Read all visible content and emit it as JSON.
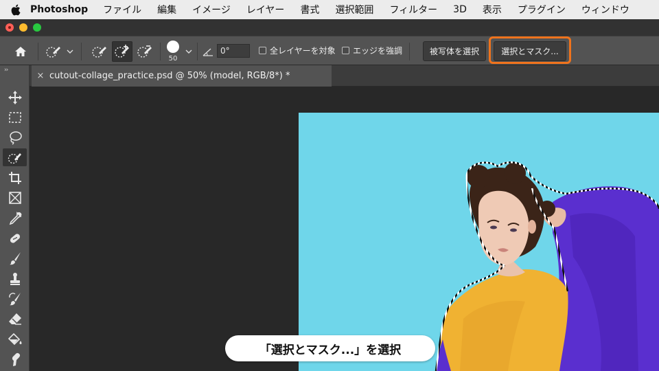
{
  "menubar": {
    "app_name": "Photoshop",
    "items": [
      "ファイル",
      "編集",
      "イメージ",
      "レイヤー",
      "書式",
      "選択範囲",
      "フィルター",
      "3D",
      "表示",
      "プラグイン",
      "ウィンドウ"
    ]
  },
  "options_bar": {
    "brush_size": "50",
    "angle_value": "0°",
    "sample_all_layers_label": "全レイヤーを対象",
    "sample_all_layers_checked": false,
    "auto_enhance_label": "エッジを強調",
    "auto_enhance_checked": false,
    "select_subject_label": "被写体を選択",
    "select_and_mask_label": "選択とマスク..."
  },
  "toolbar": {
    "collapse_glyph": "››",
    "tools": [
      {
        "icon": "move-icon"
      },
      {
        "icon": "marquee-icon"
      },
      {
        "icon": "lasso-icon"
      },
      {
        "icon": "quick-selection-icon",
        "active": true
      },
      {
        "icon": "crop-icon"
      },
      {
        "icon": "frame-icon"
      },
      {
        "icon": "eyedropper-icon"
      },
      {
        "icon": "healing-brush-icon"
      },
      {
        "icon": "brush-icon"
      },
      {
        "icon": "clone-stamp-icon"
      },
      {
        "icon": "history-brush-icon"
      },
      {
        "icon": "eraser-icon"
      },
      {
        "icon": "paint-bucket-icon"
      },
      {
        "icon": "smudge-icon"
      }
    ]
  },
  "document": {
    "tab_title": "cutout-collage_practice.psd @ 50% (model, RGB/8*) *",
    "close_glyph": "×"
  },
  "caption": "「選択とマスク...」を選択",
  "colors": {
    "highlight": "#f0731c",
    "photo_background": "#6fd6ea",
    "sweater": "#f0b232",
    "jacket": "#5a2fcf"
  }
}
